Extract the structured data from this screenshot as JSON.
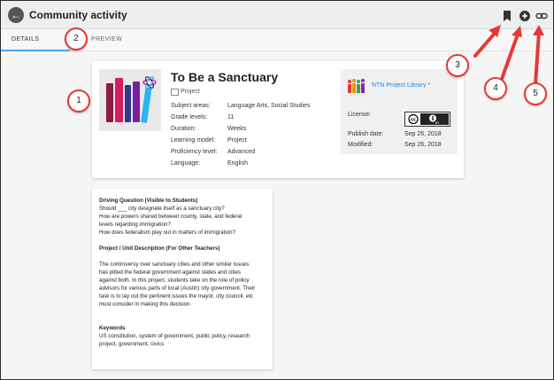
{
  "header": {
    "title": "Community activity",
    "back_icon": "arrow-left-icon"
  },
  "toolbar": {
    "icons": [
      "bookmark-icon",
      "add-circle-icon",
      "link-icon"
    ]
  },
  "tabs": [
    {
      "label": "DETAILS",
      "active": true
    },
    {
      "label": "PREVIEW",
      "active": false
    }
  ],
  "resource": {
    "title": "To Be a Sanctuary",
    "type": "Project",
    "fields": [
      {
        "label": "Subject areas:",
        "value": "Language Arts, Social Studies"
      },
      {
        "label": "Grade levels:",
        "value": "11"
      },
      {
        "label": "Duration:",
        "value": "Weeks"
      },
      {
        "label": "Learning model:",
        "value": "Project"
      },
      {
        "label": "Proficiency level:",
        "value": "Advanced"
      },
      {
        "label": "Language:",
        "value": "English"
      }
    ]
  },
  "library": {
    "name": "NTN Project Library *",
    "license_label": "License:",
    "publish_label": "Publish date:",
    "publish_value": "Sep 26, 2018",
    "modified_label": "Modified:",
    "modified_value": "Sep 26, 2018",
    "license_badge_text": "BY"
  },
  "description": {
    "driving_heading": "Driving Question (Visible to Students)",
    "driving_lines": [
      "Should ___ city designate itself as a sanctuary city?",
      "How are powers shared between county, state, and federal",
      "levels regarding immigration?",
      "How does federalism play out in matters of immigration?"
    ],
    "project_heading": "Project / Unit Description (For Other Teachers)",
    "project_lines": [
      "The controversy over sanctuary cities and other similar issues",
      "has pitted the federal government against states and cities",
      "against both. In this project, students take on the role of policy",
      "advisors for various parts of local (Austin) city government. Their",
      "task is to lay out the pertinent issues the mayor, city council, etc",
      "must consider in making this decision."
    ],
    "keywords_heading": "Keywords",
    "keywords_lines": [
      "US constitution, system of government, public policy, research",
      "project, government, civics"
    ]
  },
  "callouts": [
    "1",
    "2",
    "3",
    "4",
    "5"
  ],
  "colors": {
    "accent": "#42a5f5",
    "callout_border": "#e53935",
    "link": "#1e88e5"
  }
}
